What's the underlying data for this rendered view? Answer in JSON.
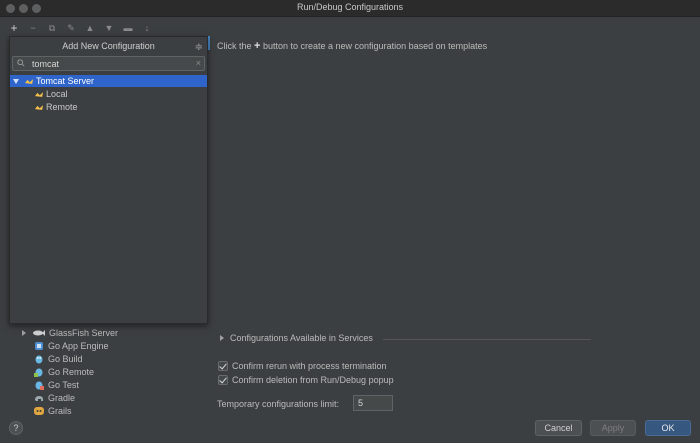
{
  "window": {
    "title": "Run/Debug Configurations"
  },
  "toolbar": {
    "items": [
      {
        "icon": "plus-icon",
        "glyph": "+"
      },
      {
        "icon": "minus-icon",
        "glyph": "−"
      },
      {
        "icon": "copy-icon",
        "glyph": "⧉"
      },
      {
        "icon": "wrench-icon",
        "glyph": "✎"
      },
      {
        "icon": "arrow-up-icon",
        "glyph": "▲"
      },
      {
        "icon": "arrow-down-icon",
        "glyph": "▼"
      },
      {
        "icon": "folder-icon",
        "glyph": "▬"
      },
      {
        "icon": "sort-icon",
        "glyph": "↓"
      }
    ]
  },
  "popup": {
    "title": "Add New Configuration",
    "search_value": "tomcat",
    "clear_glyph": "×",
    "tree": {
      "group": "Tomcat Server",
      "children": [
        "Local",
        "Remote"
      ]
    }
  },
  "hint": {
    "prefix": "Click the",
    "plus": "+",
    "suffix": "button to create a new configuration based on templates"
  },
  "templates": [
    "GlassFish Server",
    "Go App Engine",
    "Go Build",
    "Go Remote",
    "Go Test",
    "Gradle",
    "Grails"
  ],
  "services": {
    "label": "Configurations Available in Services"
  },
  "options": {
    "confirm_rerun": "Confirm rerun with process termination",
    "confirm_deletion": "Confirm deletion from Run/Debug popup",
    "limit_label": "Temporary configurations limit:",
    "limit_value": "5"
  },
  "buttons": {
    "help": "?",
    "cancel": "Cancel",
    "apply": "Apply",
    "ok": "OK"
  },
  "colors": {
    "selection": "#2f65ca",
    "ok_button": "#365880",
    "background": "#3c3f41"
  }
}
